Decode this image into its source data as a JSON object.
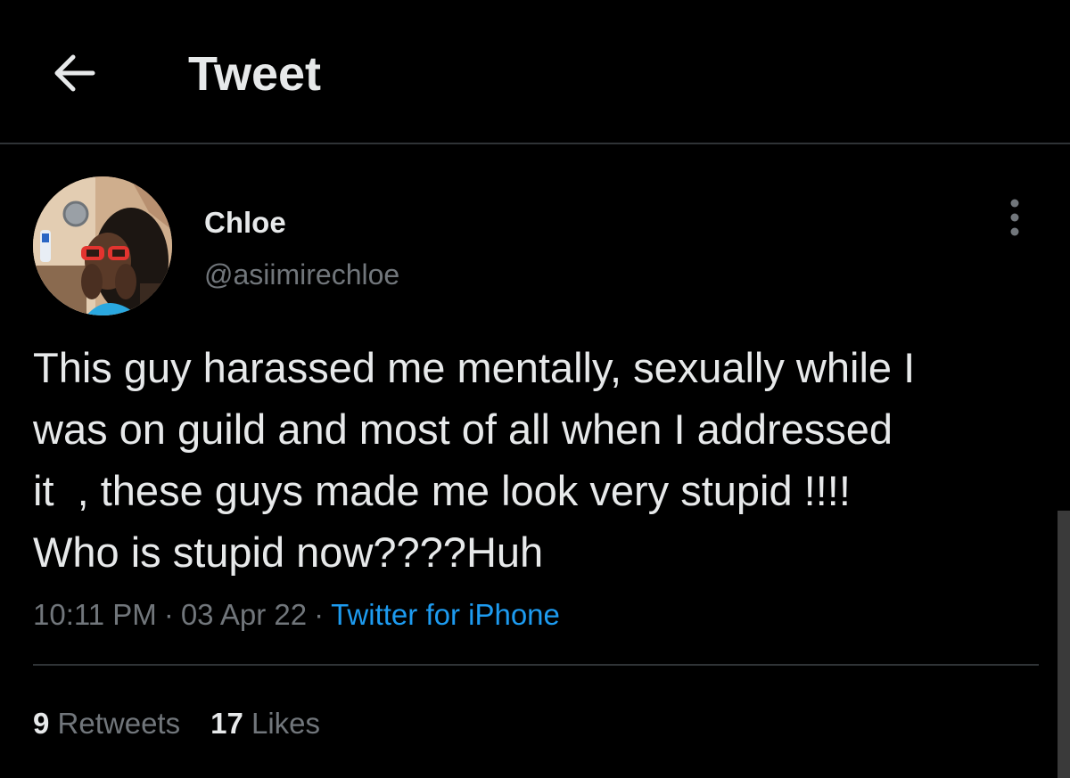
{
  "header": {
    "title": "Tweet",
    "back_icon": "back-arrow-icon"
  },
  "tweet": {
    "author": {
      "display_name": "Chloe",
      "handle": "@asiimirechloe"
    },
    "text": "This guy harassed me mentally, sexually while I\nwas on guild and most of all when I addressed\nit  , these guys made me look very stupid !!!!\nWho is stupid now????Huh",
    "time": "10:11 PM",
    "date": "03 Apr 22",
    "separator": "·",
    "source": "Twitter for iPhone",
    "retweets_count": "9",
    "retweets_label": "Retweets",
    "likes_count": "17",
    "likes_label": "Likes"
  },
  "colors": {
    "background": "#000000",
    "text_primary": "#e7e9ea",
    "text_secondary": "#71767b",
    "link": "#1d9bf0",
    "divider": "#2f3336"
  }
}
